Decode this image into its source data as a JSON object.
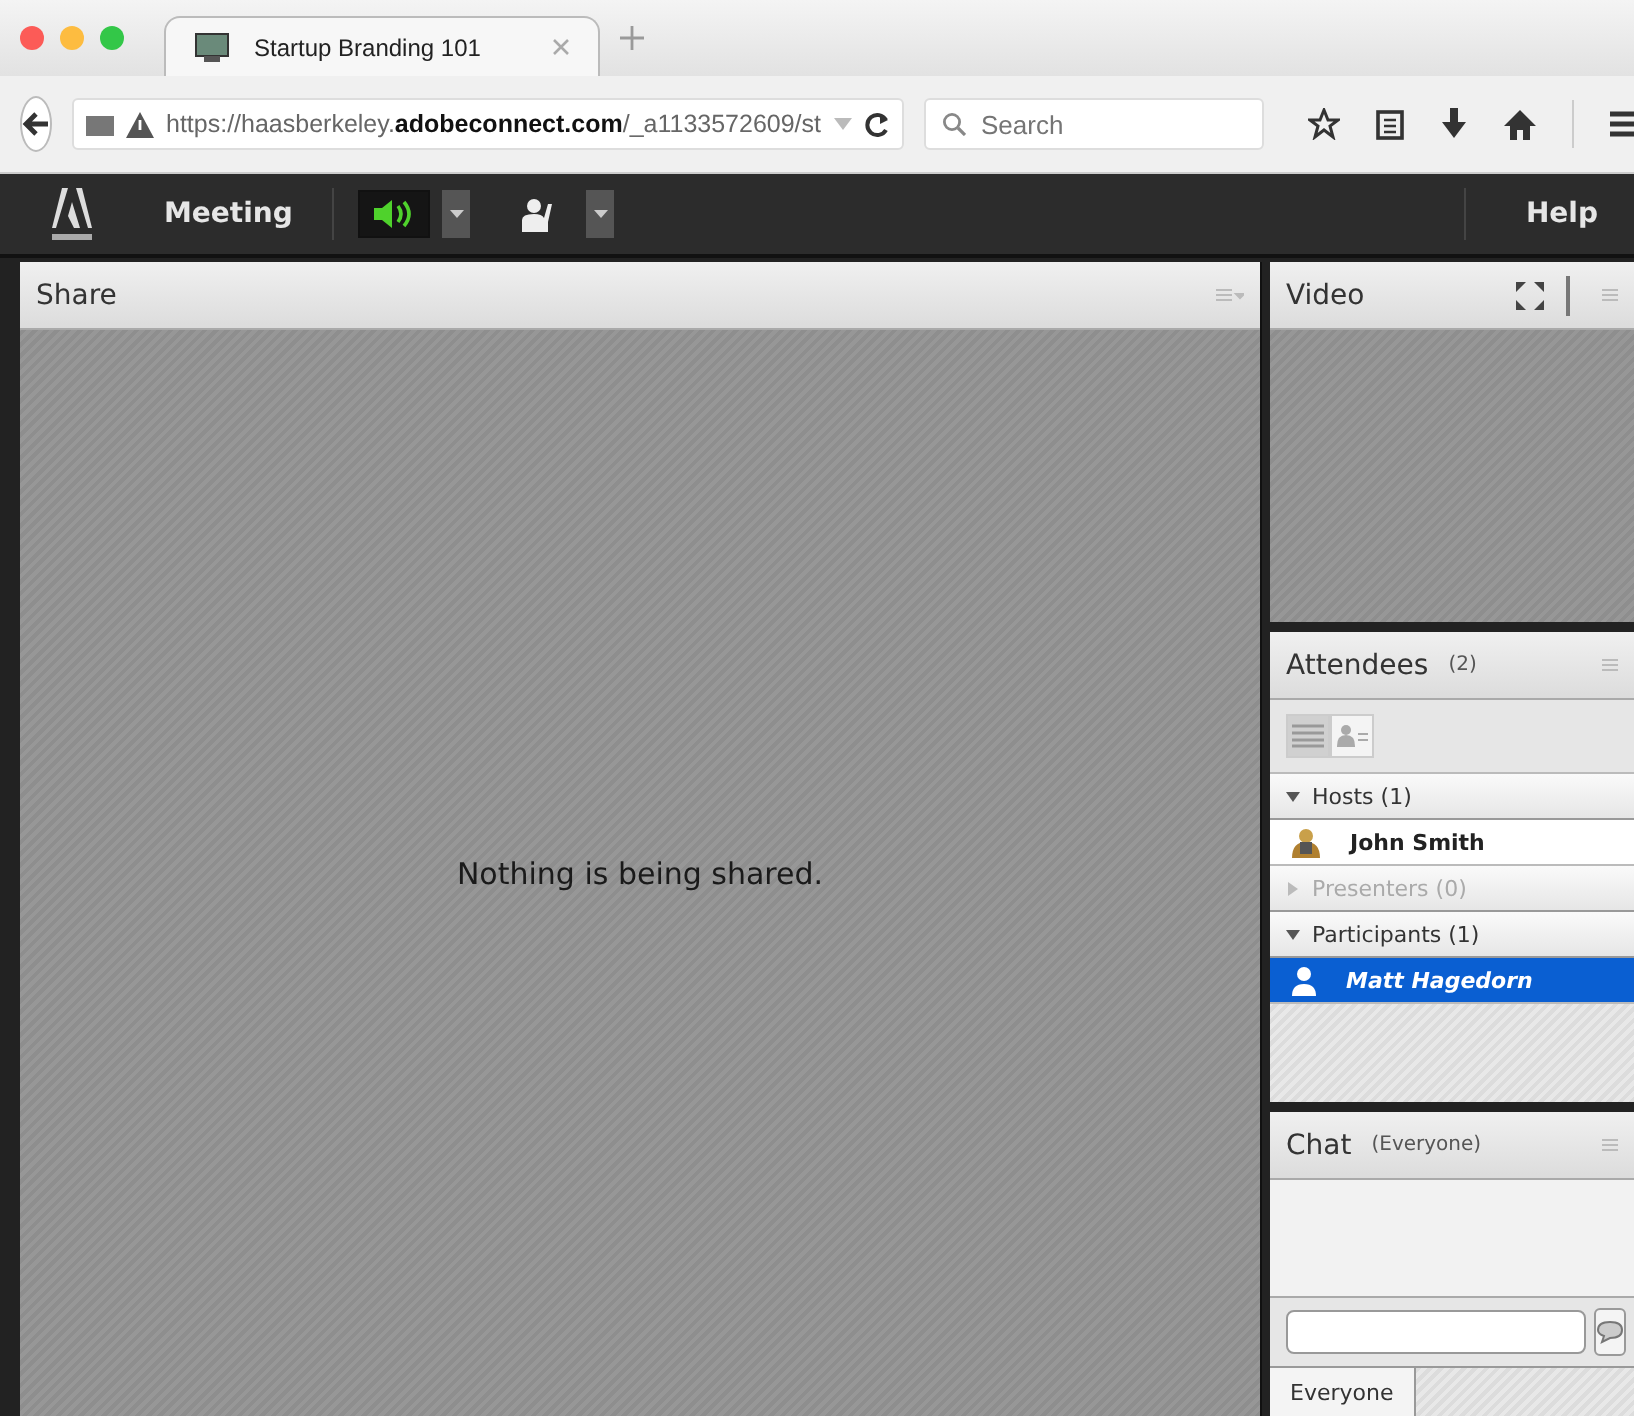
{
  "browser": {
    "tab_title": "Startup Branding 101",
    "url": "https://haasberkeley.**adobeconnect.com**/_a1133572609/st",
    "search_placeholder": "Search"
  },
  "app_bar": {
    "menu": "Meeting",
    "help": "Help"
  },
  "share": {
    "title": "Share",
    "message": "Nothing is being shared."
  },
  "video": {
    "title": "Video"
  },
  "attendees": {
    "title": "Attendees",
    "count": "(2)",
    "groups": [
      {
        "label": "Hosts (1)",
        "expanded": true,
        "disabled": false,
        "children": [
          {
            "name": "John Smith",
            "kind": "host",
            "selected": false
          }
        ]
      },
      {
        "label": "Presenters (0)",
        "expanded": false,
        "disabled": true
      },
      {
        "label": "Participants (1)",
        "expanded": true,
        "disabled": false,
        "children": [
          {
            "name": "Matt Hagedorn",
            "kind": "participant",
            "selected": true
          }
        ]
      }
    ]
  },
  "chat": {
    "title": "Chat",
    "scope": "(Everyone)",
    "tabs": [
      {
        "label": "Everyone",
        "selected": true
      }
    ]
  }
}
